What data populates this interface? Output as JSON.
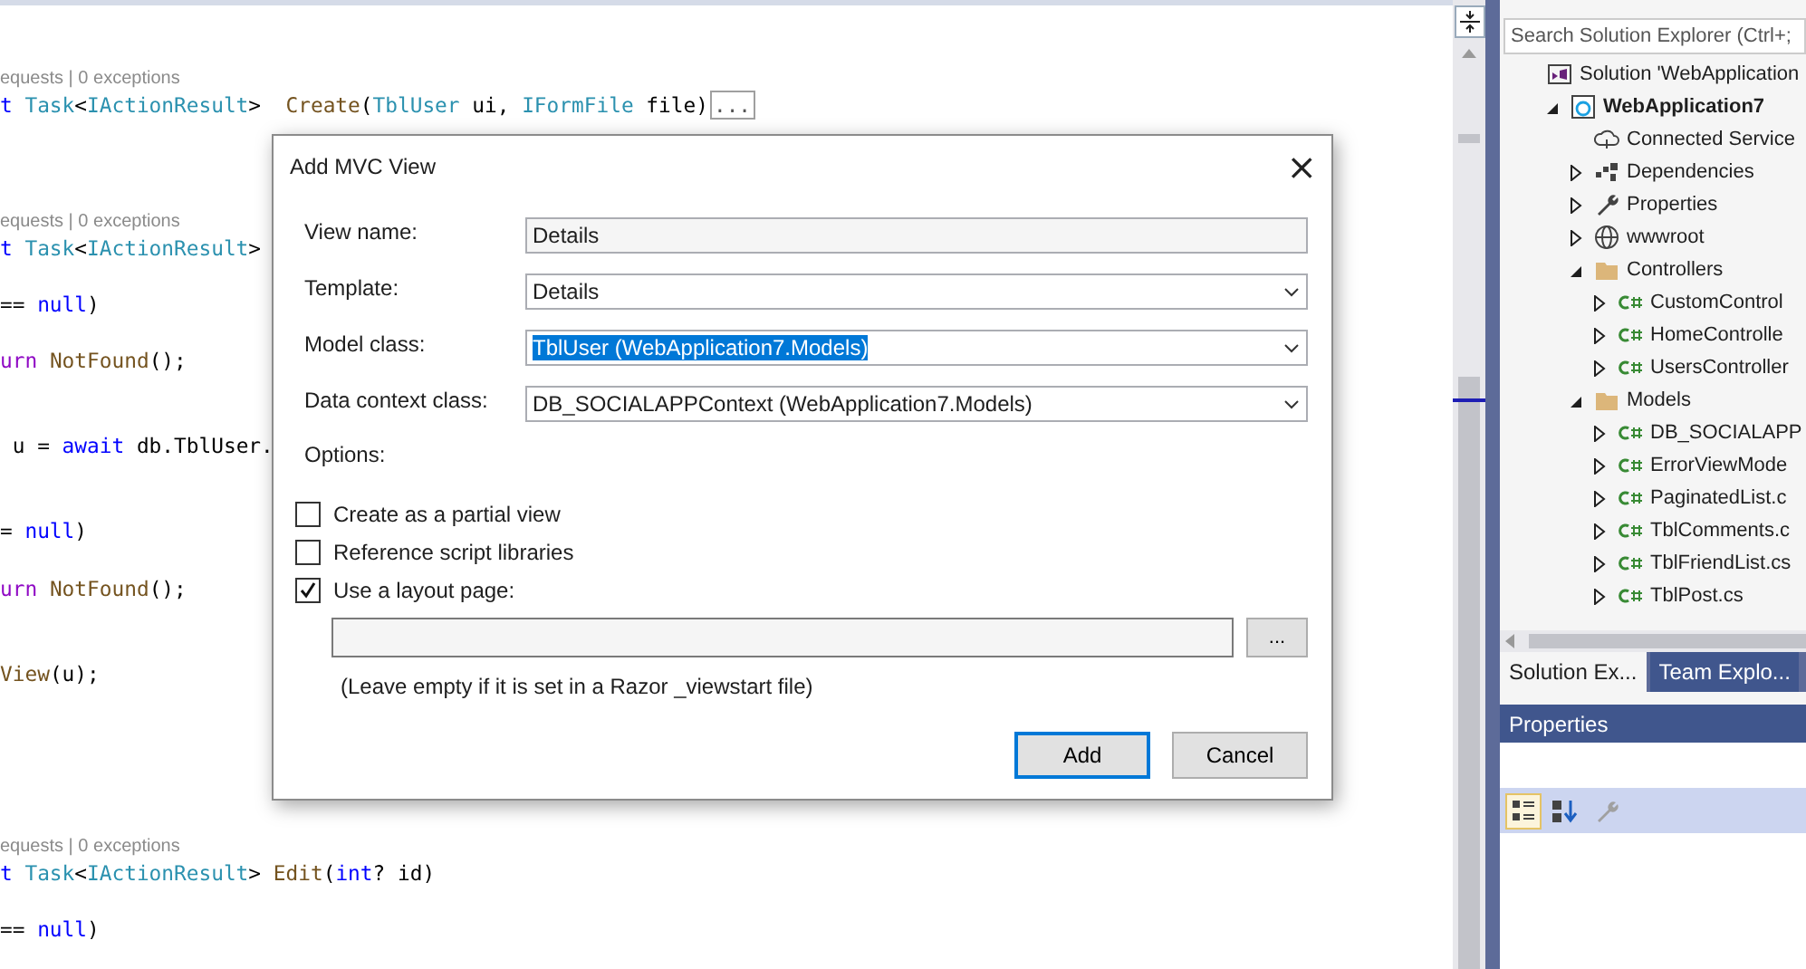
{
  "editor": {
    "lines": [
      {
        "kind": "blank"
      },
      {
        "kind": "blank"
      },
      {
        "kind": "lens",
        "text": "equests | 0 exceptions"
      },
      {
        "kind": "code",
        "tokens": [
          {
            "text": "t ",
            "kind": "keyword"
          },
          {
            "text": "Task",
            "kind": "type"
          },
          {
            "text": "<",
            "kind": "plain"
          },
          {
            "text": "IActionResult",
            "kind": "type"
          },
          {
            "text": ">  ",
            "kind": "plain"
          },
          {
            "text": "Create",
            "kind": "method"
          },
          {
            "text": "(",
            "kind": "plain"
          },
          {
            "text": "TblUser",
            "kind": "type"
          },
          {
            "text": " ui, ",
            "kind": "plain"
          },
          {
            "text": "IFormFile",
            "kind": "type"
          },
          {
            "text": " file)",
            "kind": "plain"
          },
          {
            "text": "...",
            "kind": "collapsed"
          }
        ]
      },
      {
        "kind": "blank"
      },
      {
        "kind": "blank"
      },
      {
        "kind": "blank"
      },
      {
        "kind": "lens",
        "text": "equests | 0 exceptions"
      },
      {
        "kind": "code",
        "tokens": [
          {
            "text": "t ",
            "kind": "keyword"
          },
          {
            "text": "Task",
            "kind": "type"
          },
          {
            "text": "<",
            "kind": "plain"
          },
          {
            "text": "IActionResult",
            "kind": "type"
          },
          {
            "text": ">",
            "kind": "plain"
          }
        ]
      },
      {
        "kind": "blank"
      },
      {
        "kind": "code",
        "tokens": [
          {
            "text": "== ",
            "kind": "plain"
          },
          {
            "text": "null",
            "kind": "keyword"
          },
          {
            "text": ")",
            "kind": "plain"
          }
        ]
      },
      {
        "kind": "blank"
      },
      {
        "kind": "code",
        "tokens": [
          {
            "text": "urn ",
            "kind": "control"
          },
          {
            "text": "NotFound",
            "kind": "method"
          },
          {
            "text": "();",
            "kind": "plain"
          }
        ]
      },
      {
        "kind": "blank"
      },
      {
        "kind": "blank"
      },
      {
        "kind": "code",
        "tokens": [
          {
            "text": " u = ",
            "kind": "plain"
          },
          {
            "text": "await",
            "kind": "keyword"
          },
          {
            "text": " db.TblUser.",
            "kind": "plain"
          }
        ]
      },
      {
        "kind": "blank"
      },
      {
        "kind": "blank"
      },
      {
        "kind": "code",
        "tokens": [
          {
            "text": "= ",
            "kind": "plain"
          },
          {
            "text": "null",
            "kind": "keyword"
          },
          {
            "text": ")",
            "kind": "plain"
          }
        ]
      },
      {
        "kind": "blank"
      },
      {
        "kind": "code",
        "tokens": [
          {
            "text": "urn ",
            "kind": "control"
          },
          {
            "text": "NotFound",
            "kind": "method"
          },
          {
            "text": "();",
            "kind": "plain"
          }
        ]
      },
      {
        "kind": "blank"
      },
      {
        "kind": "blank"
      },
      {
        "kind": "code",
        "tokens": [
          {
            "text": "View",
            "kind": "method"
          },
          {
            "text": "(u);",
            "kind": "plain"
          }
        ]
      },
      {
        "kind": "blank"
      },
      {
        "kind": "blank"
      },
      {
        "kind": "blank"
      },
      {
        "kind": "blank"
      },
      {
        "kind": "blank"
      },
      {
        "kind": "lens",
        "text": "equests | 0 exceptions"
      },
      {
        "kind": "code",
        "tokens": [
          {
            "text": "t ",
            "kind": "keyword"
          },
          {
            "text": "Task",
            "kind": "type"
          },
          {
            "text": "<",
            "kind": "plain"
          },
          {
            "text": "IActionResult",
            "kind": "type"
          },
          {
            "text": "> ",
            "kind": "plain"
          },
          {
            "text": "Edit",
            "kind": "method"
          },
          {
            "text": "(",
            "kind": "plain"
          },
          {
            "text": "int",
            "kind": "keyword"
          },
          {
            "text": "? id)",
            "kind": "plain"
          }
        ]
      },
      {
        "kind": "blank"
      },
      {
        "kind": "code",
        "tokens": [
          {
            "text": "== ",
            "kind": "plain"
          },
          {
            "text": "null",
            "kind": "keyword"
          },
          {
            "text": ")",
            "kind": "plain"
          }
        ]
      }
    ]
  },
  "dialog": {
    "title": "Add MVC View",
    "close": "×",
    "fields": [
      {
        "label": "View name:",
        "value": "Details",
        "kind": "text",
        "highlighted": false
      },
      {
        "label": "Template:",
        "value": "Details",
        "kind": "dropdown",
        "highlighted": false
      },
      {
        "label": "Model class:",
        "value": "TblUser (WebApplication7.Models)",
        "kind": "dropdown",
        "highlighted": true
      },
      {
        "label": "Data context class:",
        "value": "DB_SOCIALAPPContext (WebApplication7.Models)",
        "kind": "dropdown",
        "highlighted": false
      }
    ],
    "options_label": "Options:",
    "options": [
      {
        "label": "Create as a partial view",
        "checked": false
      },
      {
        "label": "Reference script libraries",
        "checked": false
      },
      {
        "label": "Use a layout page:",
        "checked": true
      }
    ],
    "browse_button": "...",
    "note": "(Leave empty if it is set in a Razor _viewstart file)",
    "buttons": [
      {
        "label": "Add",
        "default": true
      },
      {
        "label": "Cancel",
        "default": false
      }
    ]
  },
  "solution_explorer": {
    "search": {
      "placeholder": "Search Solution Explorer (Ctrl+;"
    },
    "tree": [
      {
        "label": "Solution 'WebApplication",
        "kind": "solution",
        "children": [
          {
            "label": "WebApplication7",
            "kind": "web",
            "bold": true,
            "expanded": true,
            "children": [
              {
                "label": "Connected Service",
                "kind": "cloud"
              },
              {
                "label": "Dependencies",
                "kind": "deps",
                "expanded": false
              },
              {
                "label": "Properties",
                "kind": "wrench",
                "expanded": false
              },
              {
                "label": "wwwroot",
                "kind": "globe",
                "expanded": false
              },
              {
                "label": "Controllers",
                "kind": "folder",
                "expanded": true,
                "children": [
                  {
                    "label": "CustomControl",
                    "kind": "cs",
                    "expanded": false
                  },
                  {
                    "label": "HomeControlle",
                    "kind": "cs",
                    "expanded": false
                  },
                  {
                    "label": "UsersController",
                    "kind": "cs",
                    "expanded": false
                  }
                ]
              },
              {
                "label": "Models",
                "kind": "folder",
                "expanded": true,
                "children": [
                  {
                    "label": "DB_SOCIALAPP",
                    "kind": "cs",
                    "expanded": false
                  },
                  {
                    "label": "ErrorViewMode",
                    "kind": "cs",
                    "expanded": false
                  },
                  {
                    "label": "PaginatedList.c",
                    "kind": "cs",
                    "expanded": false
                  },
                  {
                    "label": "TblComments.c",
                    "kind": "cs",
                    "expanded": false
                  },
                  {
                    "label": "TblFriendList.cs",
                    "kind": "cs",
                    "expanded": false
                  },
                  {
                    "label": "TblPost.cs",
                    "kind": "cs",
                    "expanded": false
                  }
                ]
              }
            ]
          }
        ]
      }
    ],
    "tabs": [
      {
        "label": "Solution Ex...",
        "selected": true
      },
      {
        "label": "Team Explo...",
        "selected": false
      }
    ]
  },
  "properties": {
    "title": "Properties",
    "tools": [
      {
        "kind": "categorized",
        "selected": true
      },
      {
        "kind": "alphabetical",
        "selected": false
      },
      {
        "kind": "pages",
        "selected": false
      }
    ]
  }
}
